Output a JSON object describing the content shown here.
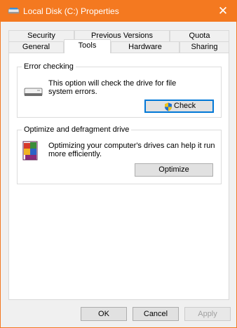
{
  "window": {
    "title": "Local Disk (C:) Properties",
    "title_icon": "drive-icon",
    "close_glyph": "✕",
    "accent_color": "#f47920"
  },
  "tabs": {
    "row1": [
      {
        "label": "Security"
      },
      {
        "label": "Previous Versions"
      },
      {
        "label": "Quota"
      }
    ],
    "row2": [
      {
        "label": "General"
      },
      {
        "label": "Tools",
        "active": true
      },
      {
        "label": "Hardware"
      },
      {
        "label": "Sharing"
      }
    ]
  },
  "error_checking": {
    "heading": "Error checking",
    "description_line1": "This option will check the drive for file",
    "description_line2": "system errors.",
    "button_label": "Check",
    "icon": "hard-drive-icon",
    "button_icon": "uac-shield-icon"
  },
  "optimize": {
    "heading": "Optimize and defragment drive",
    "description_line1": "Optimizing your computer's drives can help it run",
    "description_line2": "more efficiently.",
    "button_label": "Optimize",
    "icon": "defrag-icon"
  },
  "footer": {
    "ok_label": "OK",
    "cancel_label": "Cancel",
    "apply_label": "Apply",
    "apply_enabled": false
  }
}
